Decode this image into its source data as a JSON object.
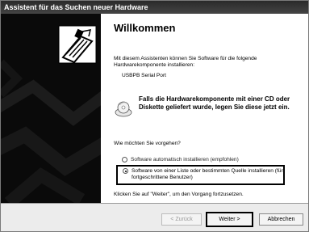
{
  "window": {
    "title": "Assistent für das Suchen neuer Hardware"
  },
  "content": {
    "heading": "Willkommen",
    "intro": "Mit diesem Assistenten können Sie Software für die folgende Hardwarekomponente installieren:",
    "device_name": "USBPB Serial Port",
    "cd_hint": "Falls die Hardwarekomponente mit einer CD oder Diskette geliefert wurde, legen Sie diese jetzt ein.",
    "question": "Wie möchten Sie vorgehen?",
    "options": [
      {
        "label": "Software automatisch installieren (empfohlen)",
        "selected": false
      },
      {
        "label": "Software von einer Liste oder bestimmten Quelle installieren (für fortgeschrittene Benutzer)",
        "selected": true
      }
    ],
    "footer": "Klicken Sie auf \"Weiter\", um den Vorgang fortzusetzen."
  },
  "buttons": {
    "back": "< Zurück",
    "next": "Weiter >",
    "cancel": "Abbrechen"
  },
  "icons": {
    "wizard": "hardware-wizard-icon",
    "cd": "cd-icon"
  }
}
